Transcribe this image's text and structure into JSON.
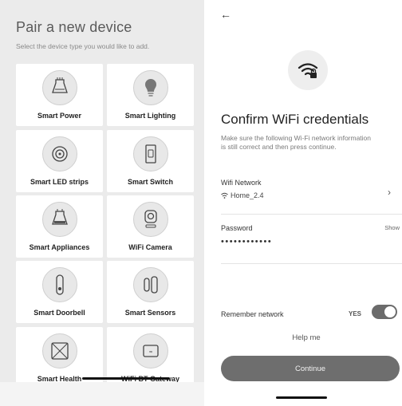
{
  "left": {
    "title": "Pair a new device",
    "subtitle": "Select the device type you would like to add.",
    "devices": [
      {
        "label": "Smart Power",
        "icon": "power-strip-icon"
      },
      {
        "label": "Smart Lighting",
        "icon": "light-bulb-icon"
      },
      {
        "label": "Smart LED strips",
        "icon": "led-strip-icon"
      },
      {
        "label": "Smart Switch",
        "icon": "wall-switch-icon"
      },
      {
        "label": "Smart Appliances",
        "icon": "appliance-icon"
      },
      {
        "label": "WiFi Camera",
        "icon": "camera-icon"
      },
      {
        "label": "Smart Doorbell",
        "icon": "doorbell-icon"
      },
      {
        "label": "Smart Sensors",
        "icon": "sensor-icon"
      },
      {
        "label": "Smart Health",
        "icon": "scale-icon"
      },
      {
        "label": "WiFi BT Gateway",
        "icon": "gateway-icon"
      }
    ]
  },
  "right": {
    "back_icon": "back-arrow-icon",
    "wifi_icon": "wifi-lock-icon",
    "title": "Confirm WiFi credentials",
    "description": "Make sure the following Wi-Fi network information is still correct and then press continue.",
    "wifi_network_label": "Wifi Network",
    "wifi_network_value": "Home_2.4",
    "password_label": "Password",
    "password_show": "Show",
    "password_value": "••••••••••••",
    "remember_label": "Remember network",
    "remember_state": "YES",
    "remember_enabled": true,
    "help_label": "Help me",
    "continue_label": "Continue"
  }
}
